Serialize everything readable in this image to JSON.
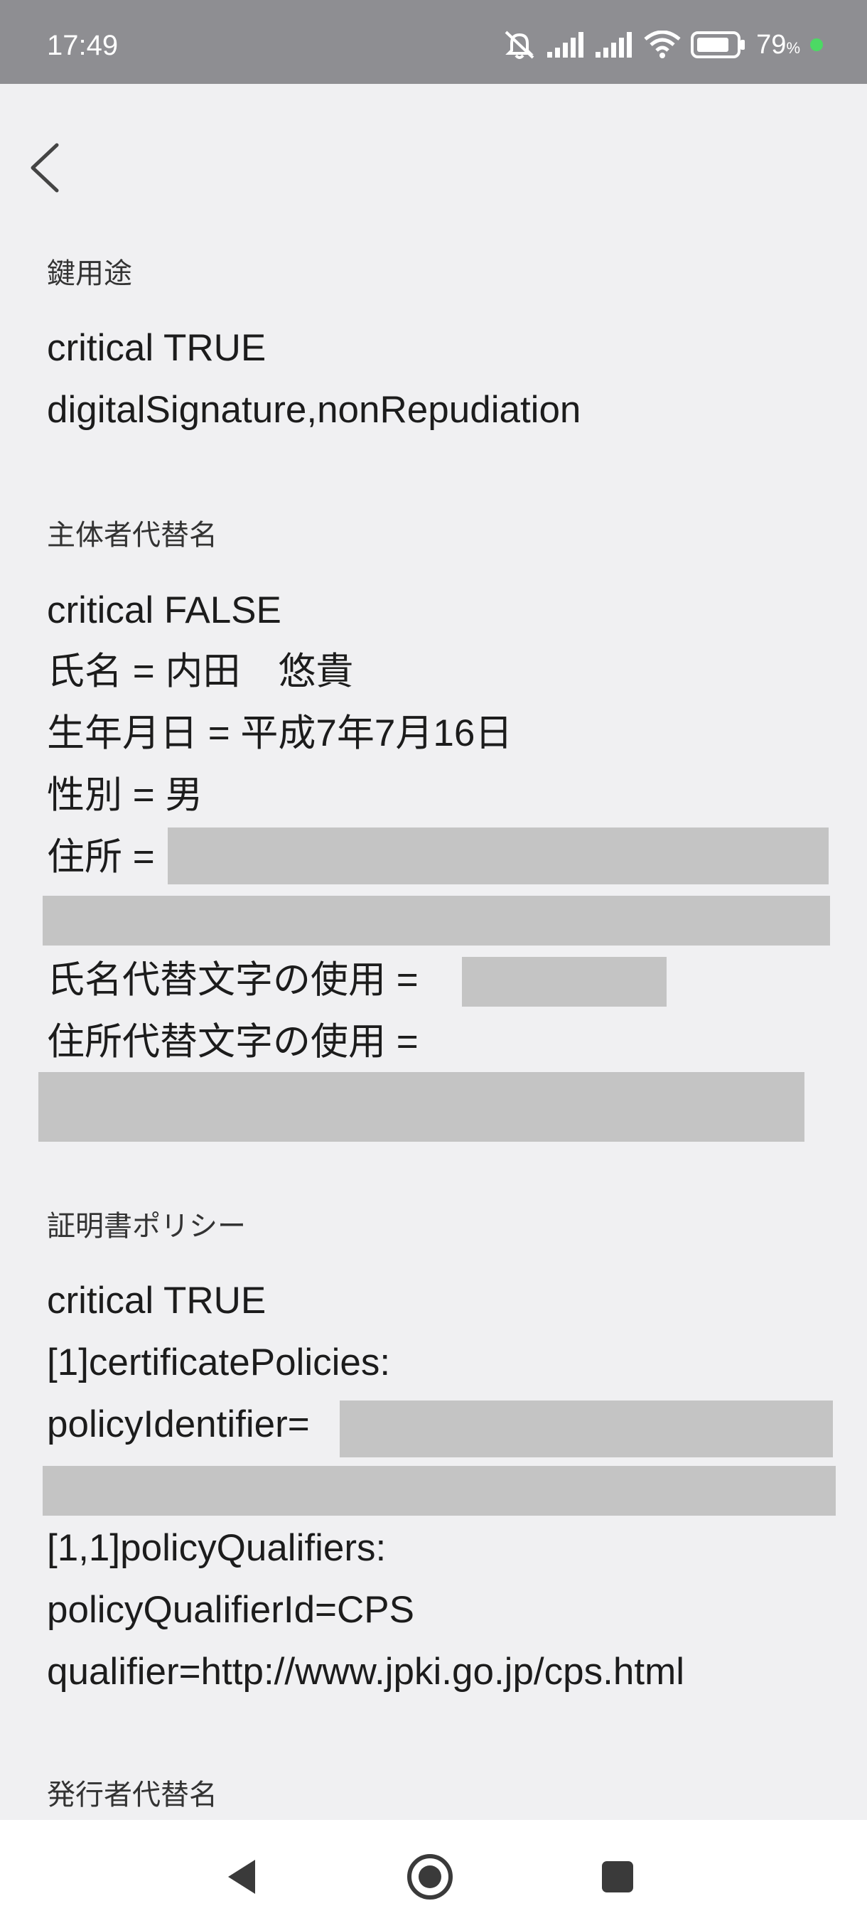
{
  "status_bar": {
    "time": "17:49",
    "battery_percent": "79",
    "battery_unit": "%",
    "icons": [
      "mute-icon",
      "signal-icon",
      "signal-icon",
      "wifi-icon",
      "battery-icon",
      "charging-dot"
    ]
  },
  "header": {
    "back_icon": "chevron-left-icon"
  },
  "sections": {
    "key_usage": {
      "title": "鍵用途",
      "lines": [
        "critical TRUE",
        "digitalSignature,nonRepudiation"
      ]
    },
    "subject_alt_name": {
      "title": "主体者代替名",
      "lines": [
        "critical FALSE",
        "氏名 = 内田　悠貴",
        "生年月日 = 平成7年7月16日",
        "性別 = 男",
        "住所 =",
        "氏名代替文字の使用 =",
        "住所代替文字の使用 ="
      ]
    },
    "cert_policy": {
      "title": "証明書ポリシー",
      "lines": [
        "critical TRUE",
        "[1]certificatePolicies:",
        "policyIdentifier=",
        "[1,1]policyQualifiers:",
        "policyQualifierId=CPS",
        "qualifier=http://www.jpki.go.jp/cps.html"
      ]
    },
    "issuer_alt_name": {
      "title": "発行者代替名"
    }
  },
  "nav": {
    "back": "triangle-back-icon",
    "home": "circle-home-icon",
    "recents": "square-recents-icon"
  },
  "colors": {
    "status_bar": "#8e8e92",
    "background": "#f0f0f2",
    "redaction": "#c4c4c4",
    "charge_dot": "#4cd964"
  }
}
